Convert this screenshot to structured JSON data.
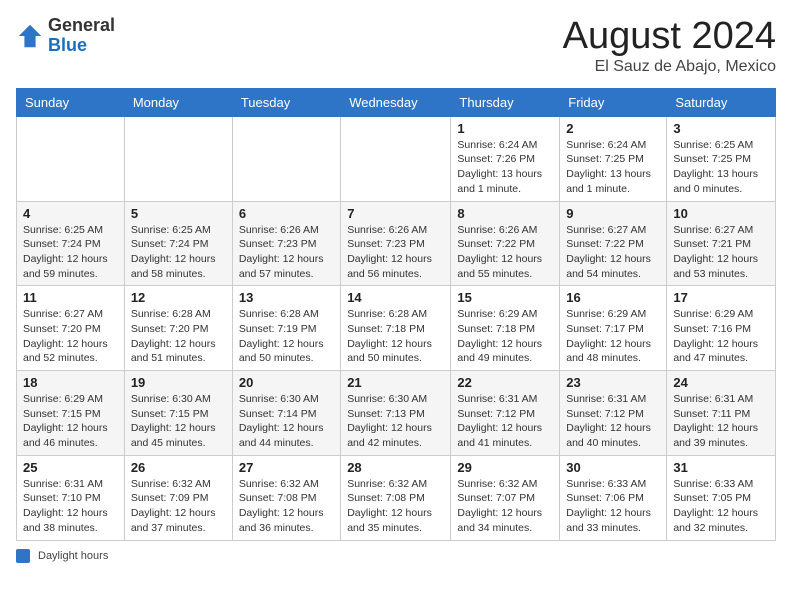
{
  "header": {
    "logo_general": "General",
    "logo_blue": "Blue",
    "month_year": "August 2024",
    "location": "El Sauz de Abajo, Mexico"
  },
  "footer": {
    "label": "Daylight hours"
  },
  "days_of_week": [
    "Sunday",
    "Monday",
    "Tuesday",
    "Wednesday",
    "Thursday",
    "Friday",
    "Saturday"
  ],
  "weeks": [
    [
      {
        "day": "",
        "info": ""
      },
      {
        "day": "",
        "info": ""
      },
      {
        "day": "",
        "info": ""
      },
      {
        "day": "",
        "info": ""
      },
      {
        "day": "1",
        "info": "Sunrise: 6:24 AM\nSunset: 7:26 PM\nDaylight: 13 hours\nand 1 minute."
      },
      {
        "day": "2",
        "info": "Sunrise: 6:24 AM\nSunset: 7:25 PM\nDaylight: 13 hours\nand 1 minute."
      },
      {
        "day": "3",
        "info": "Sunrise: 6:25 AM\nSunset: 7:25 PM\nDaylight: 13 hours\nand 0 minutes."
      }
    ],
    [
      {
        "day": "4",
        "info": "Sunrise: 6:25 AM\nSunset: 7:24 PM\nDaylight: 12 hours\nand 59 minutes."
      },
      {
        "day": "5",
        "info": "Sunrise: 6:25 AM\nSunset: 7:24 PM\nDaylight: 12 hours\nand 58 minutes."
      },
      {
        "day": "6",
        "info": "Sunrise: 6:26 AM\nSunset: 7:23 PM\nDaylight: 12 hours\nand 57 minutes."
      },
      {
        "day": "7",
        "info": "Sunrise: 6:26 AM\nSunset: 7:23 PM\nDaylight: 12 hours\nand 56 minutes."
      },
      {
        "day": "8",
        "info": "Sunrise: 6:26 AM\nSunset: 7:22 PM\nDaylight: 12 hours\nand 55 minutes."
      },
      {
        "day": "9",
        "info": "Sunrise: 6:27 AM\nSunset: 7:22 PM\nDaylight: 12 hours\nand 54 minutes."
      },
      {
        "day": "10",
        "info": "Sunrise: 6:27 AM\nSunset: 7:21 PM\nDaylight: 12 hours\nand 53 minutes."
      }
    ],
    [
      {
        "day": "11",
        "info": "Sunrise: 6:27 AM\nSunset: 7:20 PM\nDaylight: 12 hours\nand 52 minutes."
      },
      {
        "day": "12",
        "info": "Sunrise: 6:28 AM\nSunset: 7:20 PM\nDaylight: 12 hours\nand 51 minutes."
      },
      {
        "day": "13",
        "info": "Sunrise: 6:28 AM\nSunset: 7:19 PM\nDaylight: 12 hours\nand 50 minutes."
      },
      {
        "day": "14",
        "info": "Sunrise: 6:28 AM\nSunset: 7:18 PM\nDaylight: 12 hours\nand 50 minutes."
      },
      {
        "day": "15",
        "info": "Sunrise: 6:29 AM\nSunset: 7:18 PM\nDaylight: 12 hours\nand 49 minutes."
      },
      {
        "day": "16",
        "info": "Sunrise: 6:29 AM\nSunset: 7:17 PM\nDaylight: 12 hours\nand 48 minutes."
      },
      {
        "day": "17",
        "info": "Sunrise: 6:29 AM\nSunset: 7:16 PM\nDaylight: 12 hours\nand 47 minutes."
      }
    ],
    [
      {
        "day": "18",
        "info": "Sunrise: 6:29 AM\nSunset: 7:15 PM\nDaylight: 12 hours\nand 46 minutes."
      },
      {
        "day": "19",
        "info": "Sunrise: 6:30 AM\nSunset: 7:15 PM\nDaylight: 12 hours\nand 45 minutes."
      },
      {
        "day": "20",
        "info": "Sunrise: 6:30 AM\nSunset: 7:14 PM\nDaylight: 12 hours\nand 44 minutes."
      },
      {
        "day": "21",
        "info": "Sunrise: 6:30 AM\nSunset: 7:13 PM\nDaylight: 12 hours\nand 42 minutes."
      },
      {
        "day": "22",
        "info": "Sunrise: 6:31 AM\nSunset: 7:12 PM\nDaylight: 12 hours\nand 41 minutes."
      },
      {
        "day": "23",
        "info": "Sunrise: 6:31 AM\nSunset: 7:12 PM\nDaylight: 12 hours\nand 40 minutes."
      },
      {
        "day": "24",
        "info": "Sunrise: 6:31 AM\nSunset: 7:11 PM\nDaylight: 12 hours\nand 39 minutes."
      }
    ],
    [
      {
        "day": "25",
        "info": "Sunrise: 6:31 AM\nSunset: 7:10 PM\nDaylight: 12 hours\nand 38 minutes."
      },
      {
        "day": "26",
        "info": "Sunrise: 6:32 AM\nSunset: 7:09 PM\nDaylight: 12 hours\nand 37 minutes."
      },
      {
        "day": "27",
        "info": "Sunrise: 6:32 AM\nSunset: 7:08 PM\nDaylight: 12 hours\nand 36 minutes."
      },
      {
        "day": "28",
        "info": "Sunrise: 6:32 AM\nSunset: 7:08 PM\nDaylight: 12 hours\nand 35 minutes."
      },
      {
        "day": "29",
        "info": "Sunrise: 6:32 AM\nSunset: 7:07 PM\nDaylight: 12 hours\nand 34 minutes."
      },
      {
        "day": "30",
        "info": "Sunrise: 6:33 AM\nSunset: 7:06 PM\nDaylight: 12 hours\nand 33 minutes."
      },
      {
        "day": "31",
        "info": "Sunrise: 6:33 AM\nSunset: 7:05 PM\nDaylight: 12 hours\nand 32 minutes."
      }
    ]
  ]
}
